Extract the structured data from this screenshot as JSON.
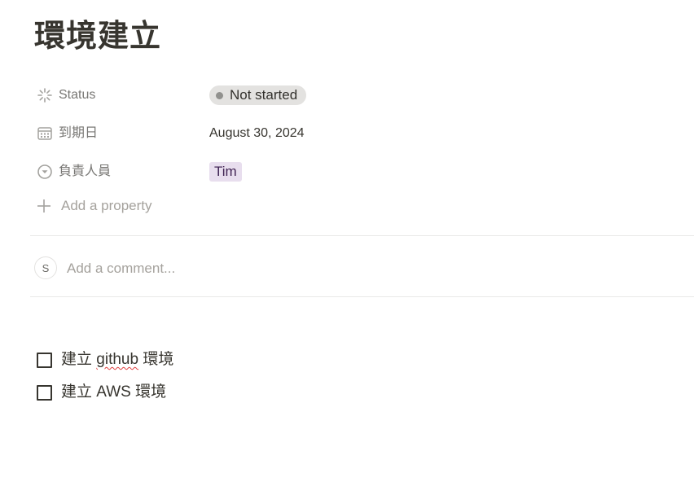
{
  "page": {
    "title": "環境建立"
  },
  "properties": [
    {
      "icon": "status-spinner-icon",
      "label": "Status",
      "value": "Not started"
    },
    {
      "icon": "calendar-icon",
      "label": "到期日",
      "value": "August 30, 2024"
    },
    {
      "icon": "person-select-icon",
      "label": "負責人員",
      "value": "Tim"
    }
  ],
  "add_property": {
    "icon": "plus-icon",
    "label": "Add a property"
  },
  "comment": {
    "avatar": "S",
    "placeholder": "Add a comment..."
  },
  "todos": [
    {
      "checked": false,
      "segments": [
        {
          "text": "建立 "
        },
        {
          "text": "github",
          "spellcheck_error": true
        },
        {
          "text": " 環境"
        }
      ]
    },
    {
      "checked": false,
      "segments": [
        {
          "text": "建立 AWS 環境"
        }
      ]
    }
  ],
  "colors": {
    "text": "#37352f",
    "muted": "#787774",
    "placeholder": "#a5a29d",
    "status_pill_bg": "#e3e2e0",
    "status_dot": "#91918e",
    "person_pill_bg": "#e8deee",
    "person_pill_text": "#412454",
    "divider": "#e9e9e7"
  }
}
